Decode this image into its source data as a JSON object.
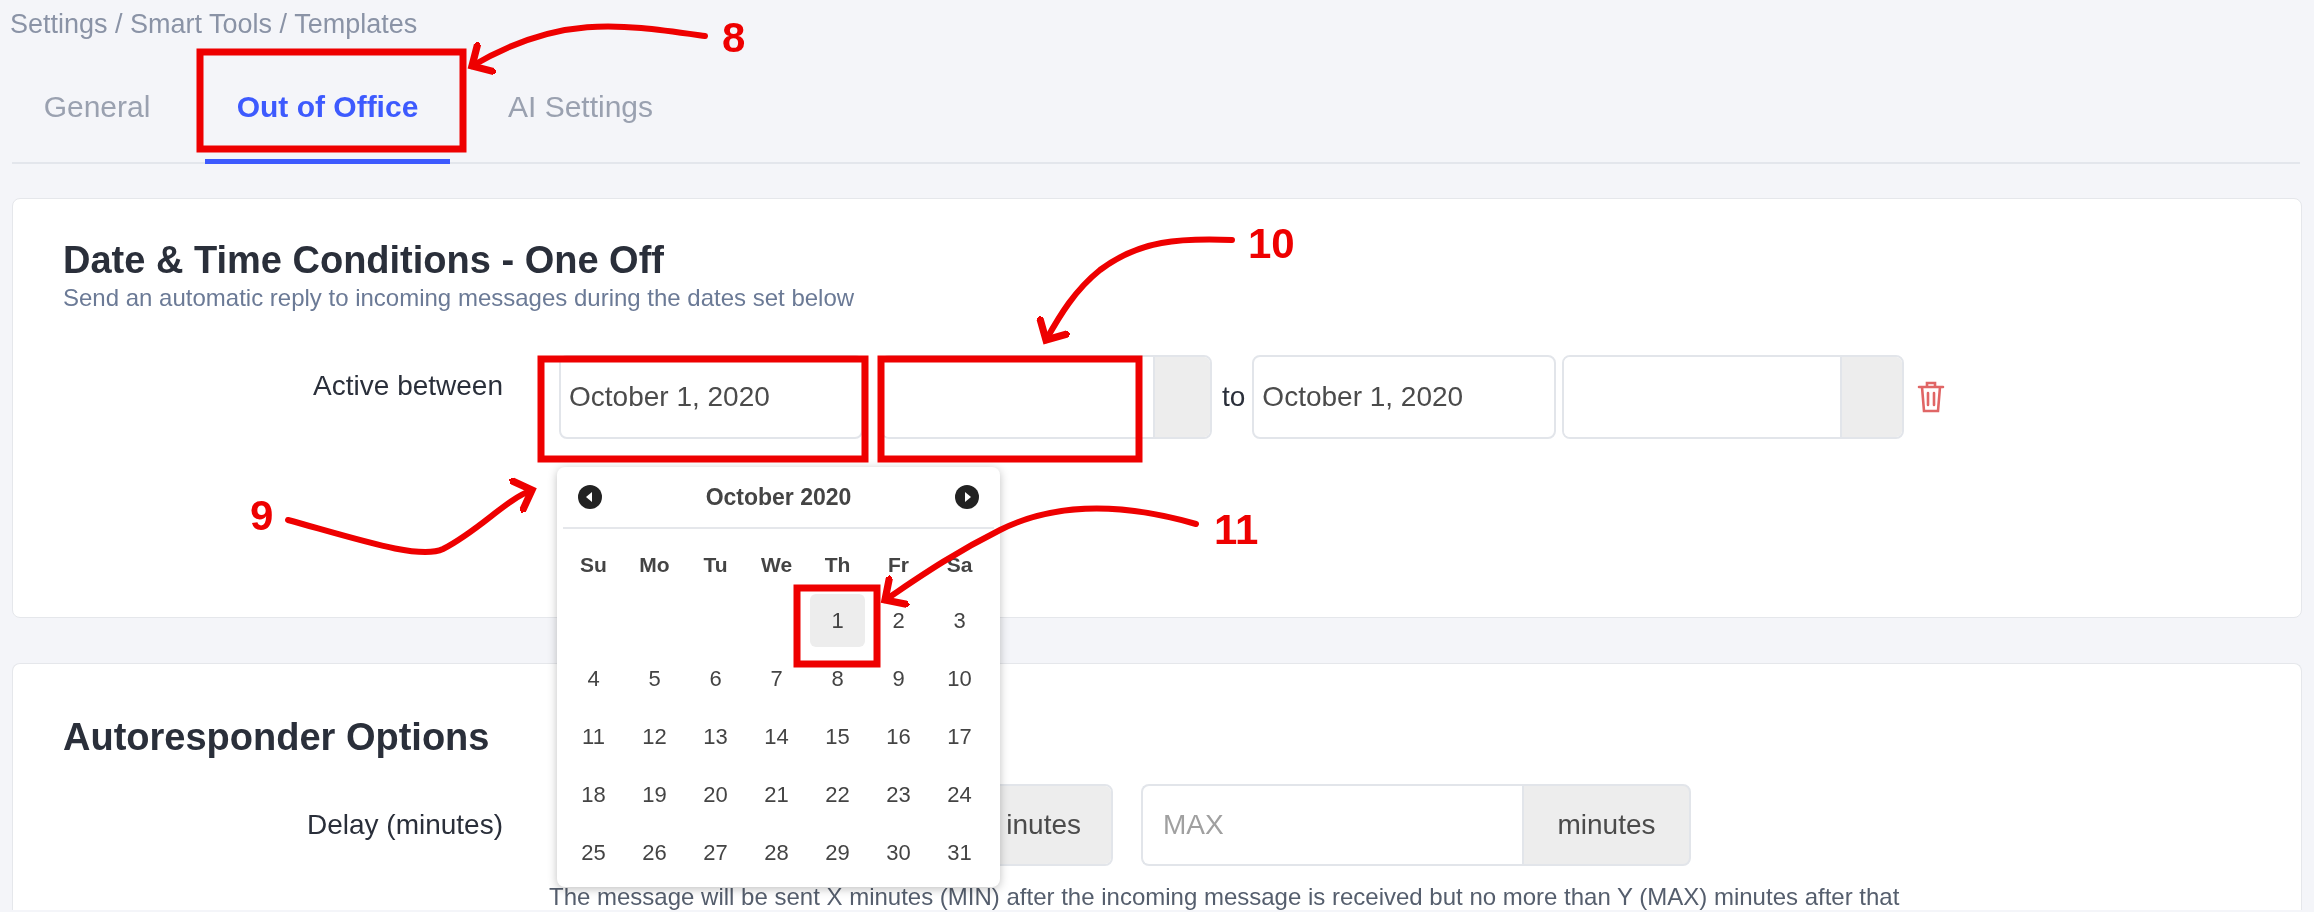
{
  "breadcrumb": "Settings / Smart Tools / Templates",
  "tabs": [
    {
      "label": "General",
      "selected": false
    },
    {
      "label": "Out of Office",
      "selected": true
    },
    {
      "label": "AI Settings",
      "selected": false
    }
  ],
  "date_conditions": {
    "title": "Date & Time Conditions - One Off",
    "subtitle": "Send an automatic reply to incoming messages during the dates set below",
    "label": "Active between",
    "start_date": "October 1, 2020",
    "separator": "to",
    "end_date": "October 1, 2020"
  },
  "date_picker": {
    "month": "October 2020",
    "weekdays": [
      "Su",
      "Mo",
      "Tu",
      "We",
      "Th",
      "Fr",
      "Sa"
    ],
    "weeks": [
      [
        {
          "day": "1",
          "selected": true
        },
        {
          "day": "2",
          "selected": false
        },
        {
          "day": "3",
          "selected": false
        }
      ],
      [
        {
          "day": "4",
          "selected": false
        },
        {
          "day": "5",
          "selected": false
        },
        {
          "day": "6",
          "selected": false
        },
        {
          "day": "7",
          "selected": false
        },
        {
          "day": "8",
          "selected": false
        },
        {
          "day": "9",
          "selected": false
        },
        {
          "day": "10",
          "selected": false
        }
      ],
      [
        {
          "day": "11",
          "selected": false
        },
        {
          "day": "12",
          "selected": false
        },
        {
          "day": "13",
          "selected": false
        },
        {
          "day": "14",
          "selected": false
        },
        {
          "day": "15",
          "selected": false
        },
        {
          "day": "16",
          "selected": false
        },
        {
          "day": "17",
          "selected": false
        }
      ],
      [
        {
          "day": "18",
          "selected": false
        },
        {
          "day": "19",
          "selected": false
        },
        {
          "day": "20",
          "selected": false
        },
        {
          "day": "21",
          "selected": false
        },
        {
          "day": "22",
          "selected": false
        },
        {
          "day": "23",
          "selected": false
        },
        {
          "day": "24",
          "selected": false
        }
      ],
      [
        {
          "day": "25",
          "selected": false
        },
        {
          "day": "26",
          "selected": false
        },
        {
          "day": "27",
          "selected": false
        },
        {
          "day": "28",
          "selected": false
        },
        {
          "day": "29",
          "selected": false
        },
        {
          "day": "30",
          "selected": false
        },
        {
          "day": "31",
          "selected": false
        }
      ]
    ]
  },
  "autoresponder": {
    "title": "Autoresponder Options",
    "label": "Delay (minutes)",
    "min_unit": "inutes",
    "max_placeholder": "MAX",
    "max_unit": "minutes",
    "help": "The message will be sent X minutes (MIN) after the incoming message is received but no more than Y (MAX) minutes after that"
  },
  "annotations": [
    {
      "label": "8"
    },
    {
      "label": "9"
    },
    {
      "label": "10"
    },
    {
      "label": "11"
    }
  ]
}
